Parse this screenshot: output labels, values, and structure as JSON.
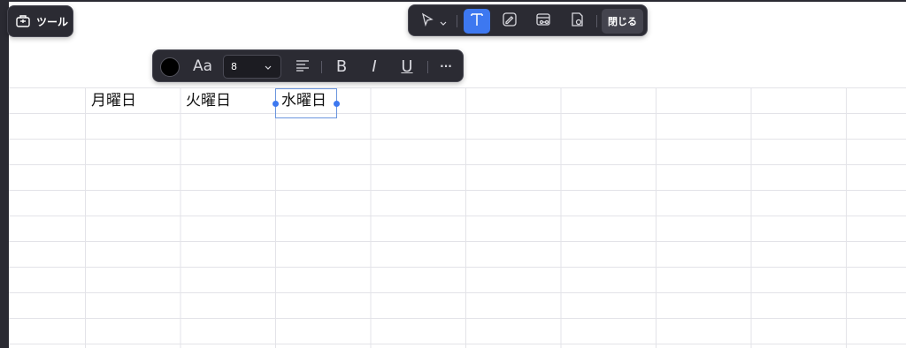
{
  "tools_panel": {
    "label": "ツール",
    "icon": "toolbox-icon"
  },
  "main_toolbar": {
    "tools": [
      {
        "name": "select-tool",
        "icon": "cursor-icon",
        "active": false
      },
      {
        "name": "text-tool",
        "icon": "text-icon",
        "active": true
      },
      {
        "name": "draw-tool",
        "icon": "draw-pen-icon",
        "active": false
      },
      {
        "name": "table-tool",
        "icon": "link-card-icon",
        "active": false
      },
      {
        "name": "stamp-tool",
        "icon": "stamp-icon",
        "active": false
      }
    ],
    "close_label": "閉じる",
    "accent_color": "#3d78f0"
  },
  "format_toolbar": {
    "text_color": "#000000",
    "font_icon_label": "Aa",
    "font_size": "8",
    "bold_label": "B",
    "italic_label": "I",
    "underline_label": "U",
    "more_label": "···"
  },
  "cells": {
    "monday": "月曜日",
    "tuesday": "火曜日",
    "wednesday": "水曜日"
  }
}
